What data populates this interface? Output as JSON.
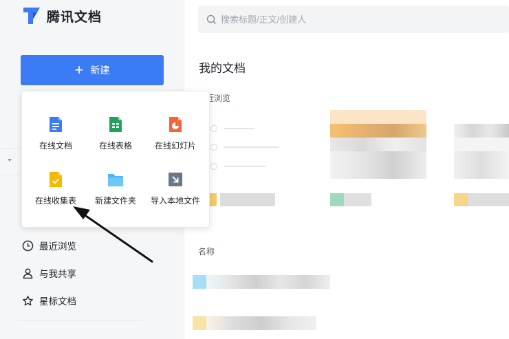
{
  "app": {
    "name": "腾讯文档"
  },
  "sidebar": {
    "new_button": "新建",
    "nav": [
      {
        "label": "最近浏览",
        "icon": "clock-icon"
      },
      {
        "label": "与我共享",
        "icon": "user-icon"
      },
      {
        "label": "星标文档",
        "icon": "star-icon"
      }
    ]
  },
  "new_menu": {
    "items": [
      {
        "label": "在线文档",
        "icon": "doc-icon",
        "color": "#3b7cf4"
      },
      {
        "label": "在线表格",
        "icon": "sheet-icon",
        "color": "#1fa25a"
      },
      {
        "label": "在线幻灯片",
        "icon": "slides-icon",
        "color": "#f2653a"
      },
      {
        "label": "在线收集表",
        "icon": "form-icon",
        "color": "#f5b800"
      },
      {
        "label": "新建文件夹",
        "icon": "folder-icon",
        "color": "#4db8f5"
      },
      {
        "label": "导入本地文件",
        "icon": "import-icon",
        "color": "#6b7785"
      }
    ]
  },
  "search": {
    "placeholder": "搜索标题/正文/创建人"
  },
  "main": {
    "section_title": "我的文档",
    "recent_label": "近浏览",
    "name_header": "名称"
  },
  "colors": {
    "accent": "#3b7cf4"
  }
}
